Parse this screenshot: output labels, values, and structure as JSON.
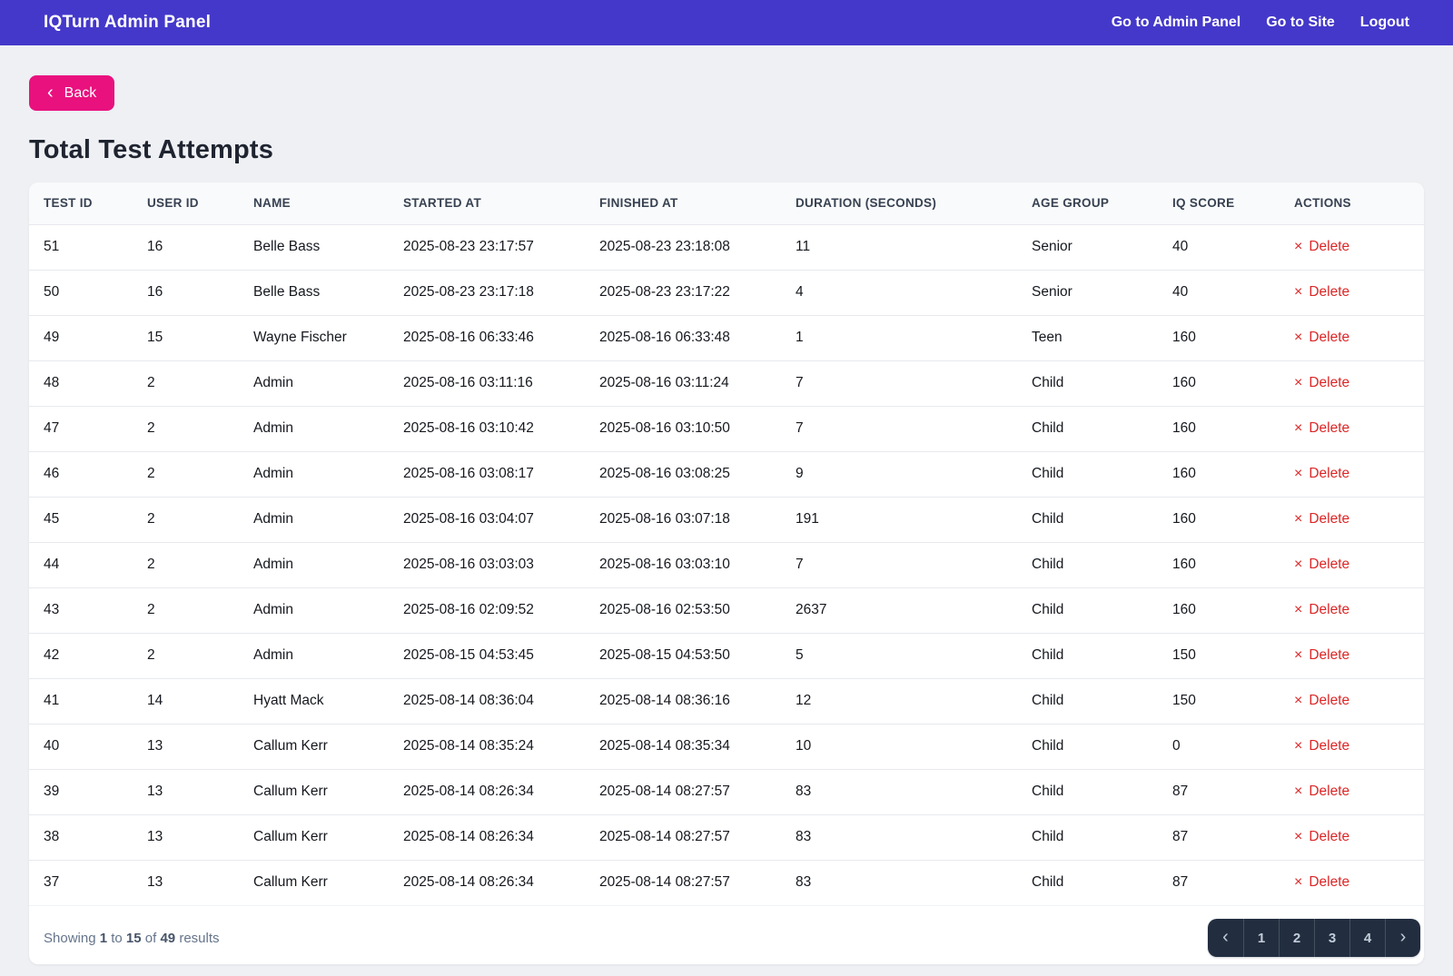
{
  "topbar": {
    "title": "IQTurn Admin Panel",
    "links": [
      {
        "label": "Go to Admin Panel"
      },
      {
        "label": "Go to Site"
      },
      {
        "label": "Logout"
      }
    ]
  },
  "back_button": {
    "icon": "‹",
    "label": "Back"
  },
  "page": {
    "title": "Total Test Attempts"
  },
  "table": {
    "columns": [
      "TEST ID",
      "USER ID",
      "NAME",
      "STARTED AT",
      "FINISHED AT",
      "DURATION (SECONDS)",
      "AGE GROUP",
      "IQ SCORE",
      "ACTIONS"
    ],
    "delete_icon": "×",
    "delete_label": "Delete",
    "rows": [
      {
        "test_id": "51",
        "user_id": "16",
        "name": "Belle Bass",
        "started_at": "2025-08-23 23:17:57",
        "finished_at": "2025-08-23 23:18:08",
        "duration": "11",
        "age_group": "Senior",
        "iq_score": "40"
      },
      {
        "test_id": "50",
        "user_id": "16",
        "name": "Belle Bass",
        "started_at": "2025-08-23 23:17:18",
        "finished_at": "2025-08-23 23:17:22",
        "duration": "4",
        "age_group": "Senior",
        "iq_score": "40"
      },
      {
        "test_id": "49",
        "user_id": "15",
        "name": "Wayne Fischer",
        "started_at": "2025-08-16 06:33:46",
        "finished_at": "2025-08-16 06:33:48",
        "duration": "1",
        "age_group": "Teen",
        "iq_score": "160"
      },
      {
        "test_id": "48",
        "user_id": "2",
        "name": "Admin",
        "started_at": "2025-08-16 03:11:16",
        "finished_at": "2025-08-16 03:11:24",
        "duration": "7",
        "age_group": "Child",
        "iq_score": "160"
      },
      {
        "test_id": "47",
        "user_id": "2",
        "name": "Admin",
        "started_at": "2025-08-16 03:10:42",
        "finished_at": "2025-08-16 03:10:50",
        "duration": "7",
        "age_group": "Child",
        "iq_score": "160"
      },
      {
        "test_id": "46",
        "user_id": "2",
        "name": "Admin",
        "started_at": "2025-08-16 03:08:17",
        "finished_at": "2025-08-16 03:08:25",
        "duration": "9",
        "age_group": "Child",
        "iq_score": "160"
      },
      {
        "test_id": "45",
        "user_id": "2",
        "name": "Admin",
        "started_at": "2025-08-16 03:04:07",
        "finished_at": "2025-08-16 03:07:18",
        "duration": "191",
        "age_group": "Child",
        "iq_score": "160"
      },
      {
        "test_id": "44",
        "user_id": "2",
        "name": "Admin",
        "started_at": "2025-08-16 03:03:03",
        "finished_at": "2025-08-16 03:03:10",
        "duration": "7",
        "age_group": "Child",
        "iq_score": "160"
      },
      {
        "test_id": "43",
        "user_id": "2",
        "name": "Admin",
        "started_at": "2025-08-16 02:09:52",
        "finished_at": "2025-08-16 02:53:50",
        "duration": "2637",
        "age_group": "Child",
        "iq_score": "160"
      },
      {
        "test_id": "42",
        "user_id": "2",
        "name": "Admin",
        "started_at": "2025-08-15 04:53:45",
        "finished_at": "2025-08-15 04:53:50",
        "duration": "5",
        "age_group": "Child",
        "iq_score": "150"
      },
      {
        "test_id": "41",
        "user_id": "14",
        "name": "Hyatt Mack",
        "started_at": "2025-08-14 08:36:04",
        "finished_at": "2025-08-14 08:36:16",
        "duration": "12",
        "age_group": "Child",
        "iq_score": "150"
      },
      {
        "test_id": "40",
        "user_id": "13",
        "name": "Callum Kerr",
        "started_at": "2025-08-14 08:35:24",
        "finished_at": "2025-08-14 08:35:34",
        "duration": "10",
        "age_group": "Child",
        "iq_score": "0"
      },
      {
        "test_id": "39",
        "user_id": "13",
        "name": "Callum Kerr",
        "started_at": "2025-08-14 08:26:34",
        "finished_at": "2025-08-14 08:27:57",
        "duration": "83",
        "age_group": "Child",
        "iq_score": "87"
      },
      {
        "test_id": "38",
        "user_id": "13",
        "name": "Callum Kerr",
        "started_at": "2025-08-14 08:26:34",
        "finished_at": "2025-08-14 08:27:57",
        "duration": "83",
        "age_group": "Child",
        "iq_score": "87"
      },
      {
        "test_id": "37",
        "user_id": "13",
        "name": "Callum Kerr",
        "started_at": "2025-08-14 08:26:34",
        "finished_at": "2025-08-14 08:27:57",
        "duration": "83",
        "age_group": "Child",
        "iq_score": "87"
      }
    ]
  },
  "footer": {
    "word_showing": "Showing",
    "from": "1",
    "word_to": "to",
    "to": "15",
    "word_of": "of",
    "total": "49",
    "word_results": "results"
  },
  "pagination": {
    "items": [
      "‹",
      "1",
      "2",
      "3",
      "4",
      "›"
    ]
  },
  "colors": {
    "topbar_bg": "#4438ca",
    "back_button_bg": "#e9117e",
    "delete_red": "#dc2626",
    "pagination_bg": "#222e40",
    "page_bg": "#eef0f4"
  }
}
